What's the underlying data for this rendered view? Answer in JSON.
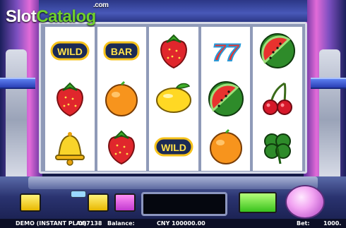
{
  "logo": {
    "slot": "Slot",
    "catalog": "Catalog",
    "dotcom": ".com"
  },
  "reels": [
    [
      "wild",
      "strawberry",
      "bell"
    ],
    [
      "bar",
      "orange",
      "strawberry"
    ],
    [
      "strawberry",
      "lemon",
      "wild"
    ],
    [
      "seven",
      "watermelon",
      "orange"
    ],
    [
      "watermelon",
      "cherries",
      "clover"
    ]
  ],
  "symbol_text": {
    "wild": "WILD",
    "bar": "BAR",
    "seven": "77"
  },
  "info": {
    "mode": "DEMO (INSTANT PLAY)",
    "id": "087138",
    "balance_label": "Balance:",
    "balance_value": "CNY 100000.00",
    "bet_label": "Bet:",
    "bet_value": "1000."
  },
  "colors": {
    "accent_magenta": "#c54fd2",
    "cabinet_blue": "#2b3786",
    "spin_button": "#f2a4f2"
  }
}
